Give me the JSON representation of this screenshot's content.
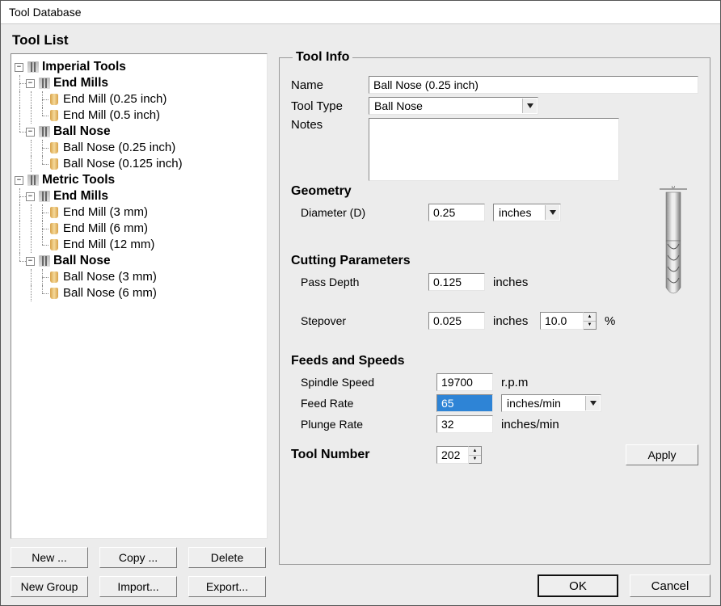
{
  "window": {
    "title": "Tool Database"
  },
  "left": {
    "title": "Tool List",
    "buttons": {
      "new": "New ...",
      "copy": "Copy ...",
      "delete": "Delete",
      "new_group": "New Group",
      "import": "Import...",
      "export": "Export..."
    },
    "tree": {
      "imperial": {
        "label": "Imperial Tools",
        "end_mills": {
          "label": "End Mills",
          "items": [
            "End Mill (0.25 inch)",
            "End Mill (0.5 inch)"
          ]
        },
        "ball_nose": {
          "label": "Ball Nose",
          "items": [
            "Ball Nose (0.25 inch)",
            "Ball Nose (0.125 inch)"
          ]
        }
      },
      "metric": {
        "label": "Metric Tools",
        "end_mills": {
          "label": "End Mills",
          "items": [
            "End Mill (3 mm)",
            "End Mill (6 mm)",
            "End Mill (12 mm)"
          ]
        },
        "ball_nose": {
          "label": "Ball Nose",
          "items": [
            "Ball Nose (3 mm)",
            "Ball Nose (6 mm)"
          ]
        }
      }
    }
  },
  "info": {
    "legend": "Tool Info",
    "name_label": "Name",
    "name_value": "Ball Nose (0.25 inch)",
    "type_label": "Tool Type",
    "type_value": "Ball Nose",
    "notes_label": "Notes",
    "notes_value": "",
    "geometry": {
      "heading": "Geometry",
      "diameter_label": "Diameter (D)",
      "diameter_value": "0.25",
      "diameter_unit": "inches"
    },
    "cutting": {
      "heading": "Cutting Parameters",
      "pass_depth_label": "Pass Depth",
      "pass_depth_value": "0.125",
      "pass_depth_unit": "inches",
      "stepover_label": "Stepover",
      "stepover_value": "0.025",
      "stepover_unit": "inches",
      "stepover_pct": "10.0",
      "stepover_pct_unit": "%"
    },
    "feeds": {
      "heading": "Feeds and Speeds",
      "spindle_label": "Spindle Speed",
      "spindle_value": "19700",
      "spindle_unit": "r.p.m",
      "feed_label": "Feed Rate",
      "feed_value": "65",
      "feed_unit": "inches/min",
      "plunge_label": "Plunge Rate",
      "plunge_value": "32",
      "plunge_unit": "inches/min"
    },
    "tool_number_label": "Tool Number",
    "tool_number_value": "202",
    "apply": "Apply"
  },
  "footer": {
    "ok": "OK",
    "cancel": "Cancel"
  }
}
